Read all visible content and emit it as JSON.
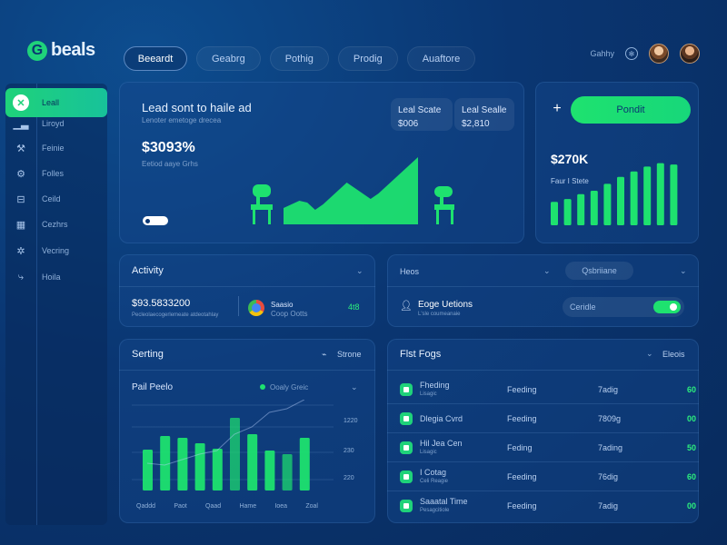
{
  "brand": {
    "logo_letter": "G",
    "name": "beals"
  },
  "topnav": [
    "Beeardt",
    "Geabrg",
    "Pothig",
    "Prodig",
    "Auaftore"
  ],
  "user": {
    "label": "Gahhy"
  },
  "sidebar": {
    "items": [
      {
        "label": "Leall",
        "icon": "x-icon"
      },
      {
        "label": "Liroyd",
        "icon": "chart-icon"
      },
      {
        "label": "Feinie",
        "icon": "wrench-icon"
      },
      {
        "label": "Folles",
        "icon": "gear-icon"
      },
      {
        "label": "Ceild",
        "icon": "lock-icon"
      },
      {
        "label": "Cezhrs",
        "icon": "grid-icon"
      },
      {
        "label": "Vecring",
        "icon": "settings-icon"
      },
      {
        "label": "Hoila",
        "icon": "share-icon"
      }
    ]
  },
  "hero": {
    "title": "Lead sont to haile ad",
    "subtitle": "Lenoter emetoge drecea",
    "value": "$3093%",
    "value_sub": "Eetiod aaye Grhs",
    "stat1": {
      "label": "Leal Scate",
      "value": "$006"
    },
    "stat2": {
      "label": "Leal Sealle",
      "value": "$2,810"
    },
    "area_chart": [
      18,
      22,
      26,
      24,
      16,
      22,
      30,
      38,
      46,
      40,
      34,
      28,
      34,
      42,
      50,
      58,
      66,
      74
    ]
  },
  "promo": {
    "button": "Pondit",
    "value": "$270K",
    "label": "Faur I Stete",
    "bars": [
      0.34,
      0.38,
      0.45,
      0.5,
      0.6,
      0.7,
      0.78,
      0.85,
      0.9,
      0.88
    ]
  },
  "activity": {
    "title": "Activity",
    "value": "$93.5833200",
    "value_sub": "Pecleolaecogerlemeate atdeotahlay",
    "app_name": "Saasio",
    "app_sub": "Coop Ootts",
    "delta": "4t8"
  },
  "people": {
    "title": "Heos",
    "search": "Qsbriiane",
    "name": "Eoge Uetions",
    "name_sub": "L'sle coumeanaie",
    "toggle_label": "Ceridle"
  },
  "sorting": {
    "title": "Serting",
    "action": "Strone",
    "chart_title": "Pail Peelo",
    "legend": "Ooaly Greic",
    "yticks": [
      "1220",
      "230",
      "220"
    ],
    "xlabels": [
      "Qaddd",
      "Paot",
      "Qaad",
      "Hame",
      "Ioea",
      "Zoal"
    ],
    "bars": [
      0.45,
      0.6,
      0.58,
      0.52,
      0.46,
      0.8,
      0.62,
      0.44,
      0.4,
      0.58
    ],
    "line": [
      0.3,
      0.28,
      0.34,
      0.4,
      0.44,
      0.62,
      0.7,
      0.86,
      0.9,
      1.0
    ]
  },
  "table": {
    "title": "Flst Fogs",
    "action": "Eleois",
    "rows": [
      {
        "name": "Fheding",
        "sub": "Lisagic",
        "c2": "Feeding",
        "c3": "7adig",
        "c4": "60"
      },
      {
        "name": "Dlegia Cvrd",
        "sub": "",
        "c2": "Feeding",
        "c3": "7809g",
        "c4": "00"
      },
      {
        "name": "Hil Jea Cen",
        "sub": "Lisagic",
        "c2": "Feding",
        "c3": "7ading",
        "c4": "50"
      },
      {
        "name": "I Cotag",
        "sub": "Celi Reagie",
        "c2": "Feeding",
        "c3": "76dig",
        "c4": "60"
      },
      {
        "name": "Saaatal Time",
        "sub": "Pesagcitiole",
        "c2": "Feeding",
        "c3": "7adig",
        "c4": "00"
      }
    ]
  },
  "colors": {
    "accent": "#1ee26f",
    "bg": "#0a3672"
  }
}
